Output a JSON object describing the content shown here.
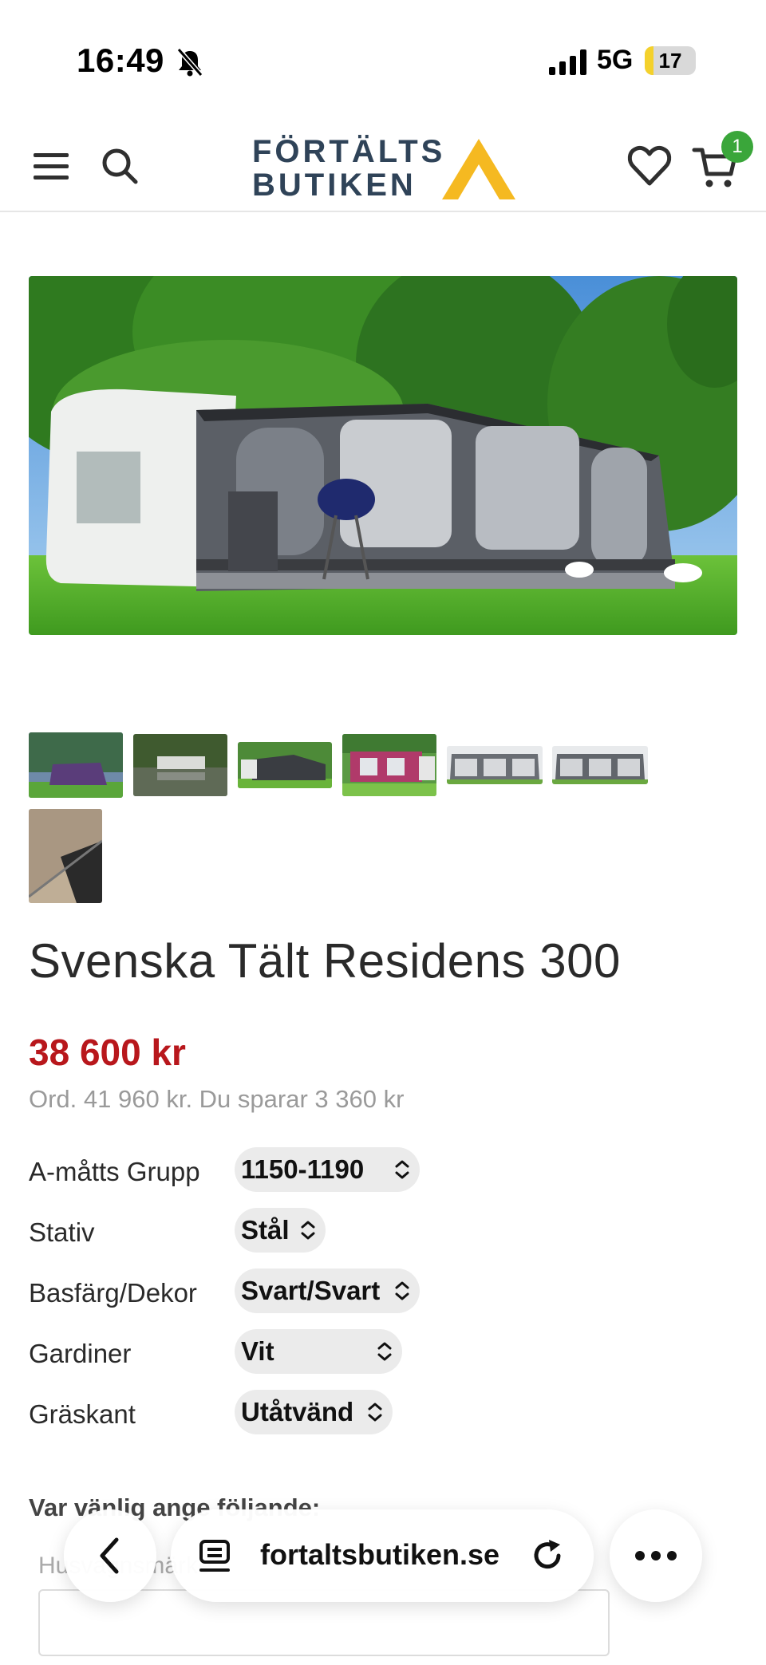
{
  "status_bar": {
    "time": "16:49",
    "network": "5G",
    "battery": "17",
    "battery_fraction": 0.17
  },
  "header": {
    "logo_line1": "FÖRTÄLTS",
    "logo_line2": "BUTIKEN",
    "cart_count": "1",
    "icons": [
      "menu-icon",
      "search-icon",
      "heart-icon",
      "cart-icon"
    ]
  },
  "product": {
    "title": "Svenska Tält Residens 300",
    "price": "38 600 kr",
    "ordinary": "Ord. 41 960 kr. Du sparar 3 360 kr",
    "options": [
      {
        "label": "A-måtts Grupp",
        "value": "1150-1190"
      },
      {
        "label": "Stativ",
        "value": "Stål"
      },
      {
        "label": "Basfärg/Dekor",
        "value": "Svart/Svart"
      },
      {
        "label": "Gardiner",
        "value": "Vit"
      },
      {
        "label": "Gräskant",
        "value": "Utåtvänd"
      }
    ],
    "note": "Var vänlig ange följande:",
    "field_label": "Husvagnsmärke"
  },
  "browser": {
    "url": "fortaltsbutiken.se"
  },
  "colors": {
    "price_red": "#b8171c",
    "logo_navy": "#2f4358",
    "logo_yellow": "#f5b921",
    "badge_green": "#3aa63a"
  }
}
